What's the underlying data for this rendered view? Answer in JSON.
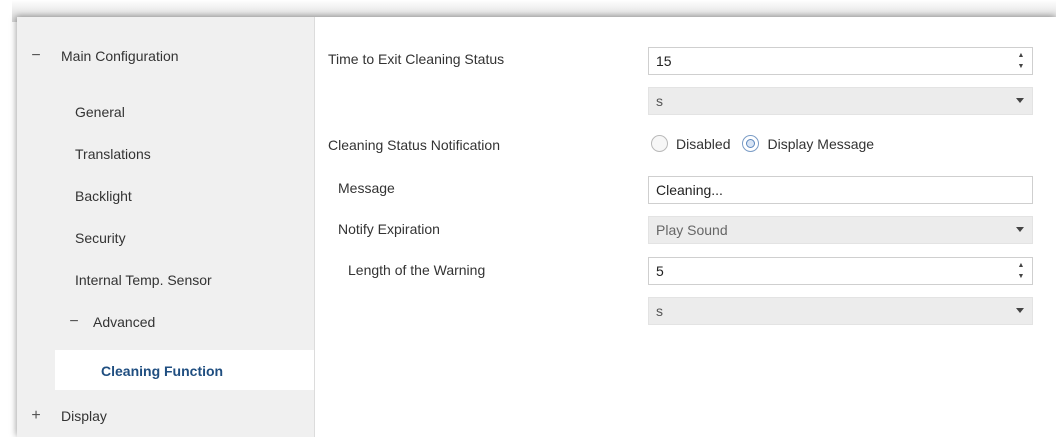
{
  "sidebar": {
    "main_configuration": {
      "expander": "−",
      "label": "Main Configuration",
      "children": [
        "General",
        "Translations",
        "Backlight",
        "Security",
        "Internal Temp. Sensor"
      ],
      "advanced": {
        "expander": "−",
        "label": "Advanced",
        "selected_child": "Cleaning Function"
      }
    },
    "display": {
      "expander": "+",
      "label": "Display"
    }
  },
  "form": {
    "time_to_exit": {
      "label": "Time to Exit Cleaning Status",
      "value": "15",
      "unit": "s"
    },
    "notification": {
      "label": "Cleaning Status Notification",
      "options": [
        {
          "label": "Disabled",
          "selected": false
        },
        {
          "label": "Display Message",
          "selected": true
        }
      ]
    },
    "message": {
      "label": "Message",
      "value": "Cleaning..."
    },
    "notify_expiration": {
      "label": "Notify Expiration",
      "value": "Play Sound"
    },
    "warning_length": {
      "label": "Length of the Warning",
      "value": "5",
      "unit": "s"
    }
  },
  "icons": {
    "spin_up": "▲",
    "spin_down": "▼"
  }
}
